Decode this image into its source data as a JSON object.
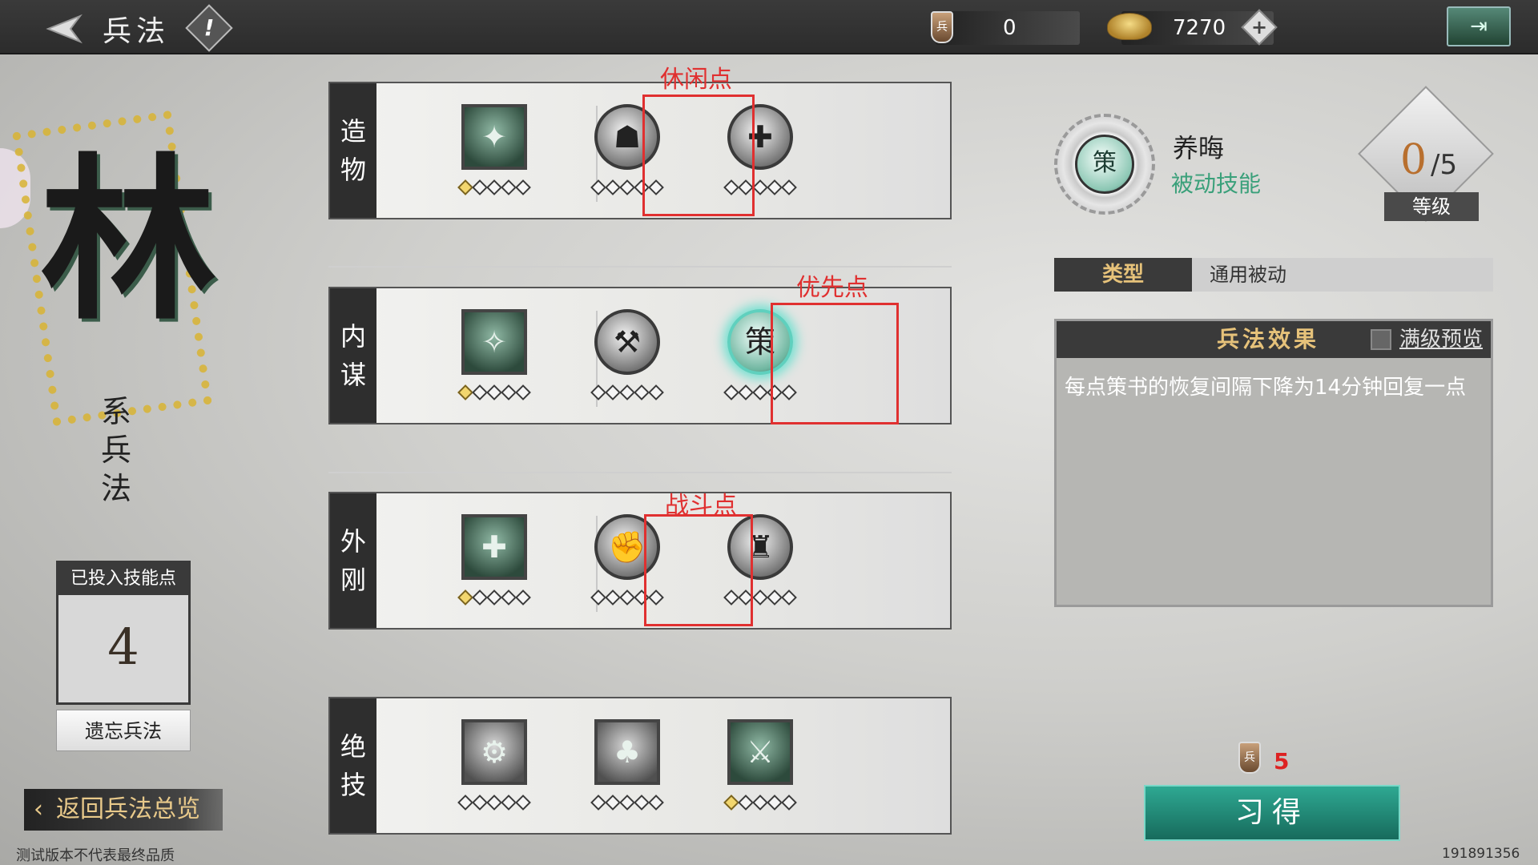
{
  "header": {
    "title": "兵法",
    "help_glyph": "!",
    "currency_bing": {
      "icon_char": "兵",
      "value": "0"
    },
    "currency_gold": {
      "value": "7270",
      "add_glyph": "+"
    },
    "exit_glyph": "⇥"
  },
  "left": {
    "seal_char": "林",
    "seal_subtitle": "系兵法",
    "invested_label": "已投入技能点",
    "invested_value": "4",
    "forget_label": "遗忘兵法",
    "return_label": "返回兵法总览",
    "footnote": "测试版本不代表最终品质"
  },
  "rows": [
    {
      "label": "造物",
      "skills": [
        {
          "glyph": "✦",
          "shape": "square",
          "filled": 1
        },
        {
          "glyph": "☗",
          "shape": "round",
          "filled": 0
        },
        {
          "glyph": "✚",
          "shape": "round",
          "filled": 0
        }
      ]
    },
    {
      "label": "内谋",
      "skills": [
        {
          "glyph": "✧",
          "shape": "square",
          "filled": 1
        },
        {
          "glyph": "⚒",
          "shape": "round",
          "filled": 0
        },
        {
          "glyph": "策",
          "shape": "round-glow",
          "filled": 0
        }
      ]
    },
    {
      "label": "外刚",
      "skills": [
        {
          "glyph": "✚",
          "shape": "square",
          "filled": 1
        },
        {
          "glyph": "✊",
          "shape": "round",
          "filled": 0
        },
        {
          "glyph": "♜",
          "shape": "round",
          "filled": 0
        }
      ]
    },
    {
      "label": "绝技",
      "skills": [
        {
          "glyph": "⚙",
          "shape": "square-gray",
          "filled": 0
        },
        {
          "glyph": "♣",
          "shape": "square-gray",
          "filled": 0
        },
        {
          "glyph": "⚔",
          "shape": "square",
          "filled": 1
        }
      ]
    }
  ],
  "annotations": {
    "casual": "休闲点",
    "priority": "优先点",
    "combat": "战斗点"
  },
  "detail": {
    "icon_char": "策",
    "name": "养晦",
    "kind": "被动技能",
    "level_current": "0",
    "level_max": "/5",
    "level_label": "等级",
    "type_key": "类型",
    "type_value": "通用被动",
    "effect_title": "兵法效果",
    "preview_label": "满级预览",
    "effect_text": "每点策书的恢复间隔下降为14分钟回复一点",
    "cost_icon_char": "兵",
    "cost": "5",
    "learn_label": "习得"
  },
  "build_id": "191891356",
  "colors": {
    "highlight": "#e03030",
    "learn_button": "#2ea892",
    "passive_green": "#3aa07a"
  }
}
